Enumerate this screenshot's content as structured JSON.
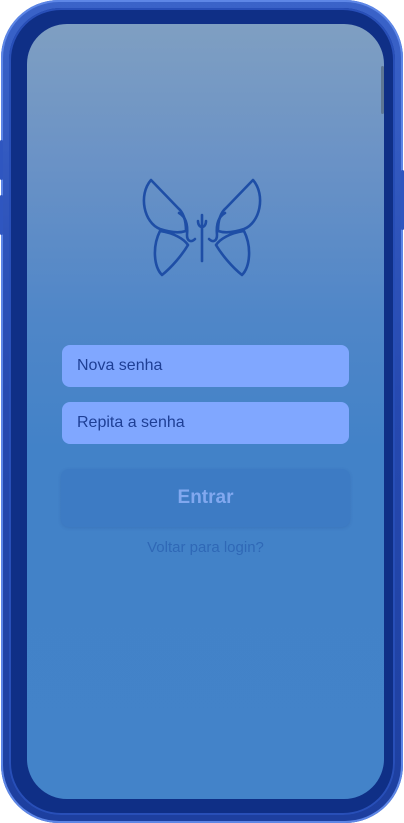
{
  "form": {
    "new_password_placeholder": "Nova senha",
    "repeat_password_placeholder": "Repita a senha",
    "submit_label": "Entrar",
    "back_link": "Voltar para login?"
  },
  "icons": {
    "logo": "butterfly-icon"
  },
  "colors": {
    "field_background": "#80a7ff",
    "field_text": "#1e3f95",
    "logo_stroke": "#1e4ea6",
    "button_text": "#81a8ef",
    "link_text": "#2f68b6",
    "device_frame": "#1d3f9f"
  }
}
